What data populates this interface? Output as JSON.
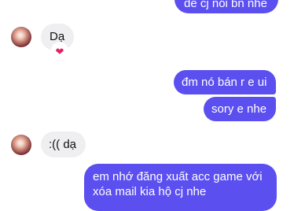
{
  "messages": [
    {
      "id": "m1",
      "direction": "outgoing",
      "text": "để cj nói bn nhe"
    },
    {
      "id": "m2",
      "direction": "incoming",
      "text": "Dạ",
      "reaction": "❤"
    },
    {
      "id": "m3",
      "direction": "outgoing",
      "text": "đm nó bán r e ui"
    },
    {
      "id": "m4",
      "direction": "outgoing",
      "text": "sory e nhe"
    },
    {
      "id": "m5",
      "direction": "incoming",
      "text": ":(( dạ"
    },
    {
      "id": "m6",
      "direction": "outgoing",
      "lines": [
        "em nhớ đăng xuất acc game với",
        "xóa mail kia hộ cj nhe"
      ]
    }
  ],
  "colors": {
    "outgoing_bubble": "#5b4ff0",
    "incoming_bubble": "#efeff1",
    "reaction_heart": "#e0245e"
  },
  "icons": {
    "reaction": "heart-icon",
    "contact_avatar": "avatar"
  }
}
